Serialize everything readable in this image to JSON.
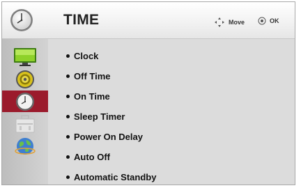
{
  "header": {
    "title": "TIME",
    "hint_move_label": "Move",
    "hint_ok_label": "OK"
  },
  "sidebar": {
    "items": [
      {
        "name": "picture",
        "icon": "tv-screen-icon"
      },
      {
        "name": "audio",
        "icon": "speaker-icon"
      },
      {
        "name": "time",
        "icon": "clock-icon",
        "active": true
      },
      {
        "name": "setup",
        "icon": "toolbox-icon"
      },
      {
        "name": "network",
        "icon": "globe-icon"
      }
    ],
    "active_color": "#9b1b2c"
  },
  "menu": {
    "items": [
      {
        "label": "Clock"
      },
      {
        "label": "Off Time"
      },
      {
        "label": "On Time"
      },
      {
        "label": "Sleep Timer"
      },
      {
        "label": "Power On Delay"
      },
      {
        "label": "Auto Off"
      },
      {
        "label": "Automatic Standby"
      }
    ]
  }
}
